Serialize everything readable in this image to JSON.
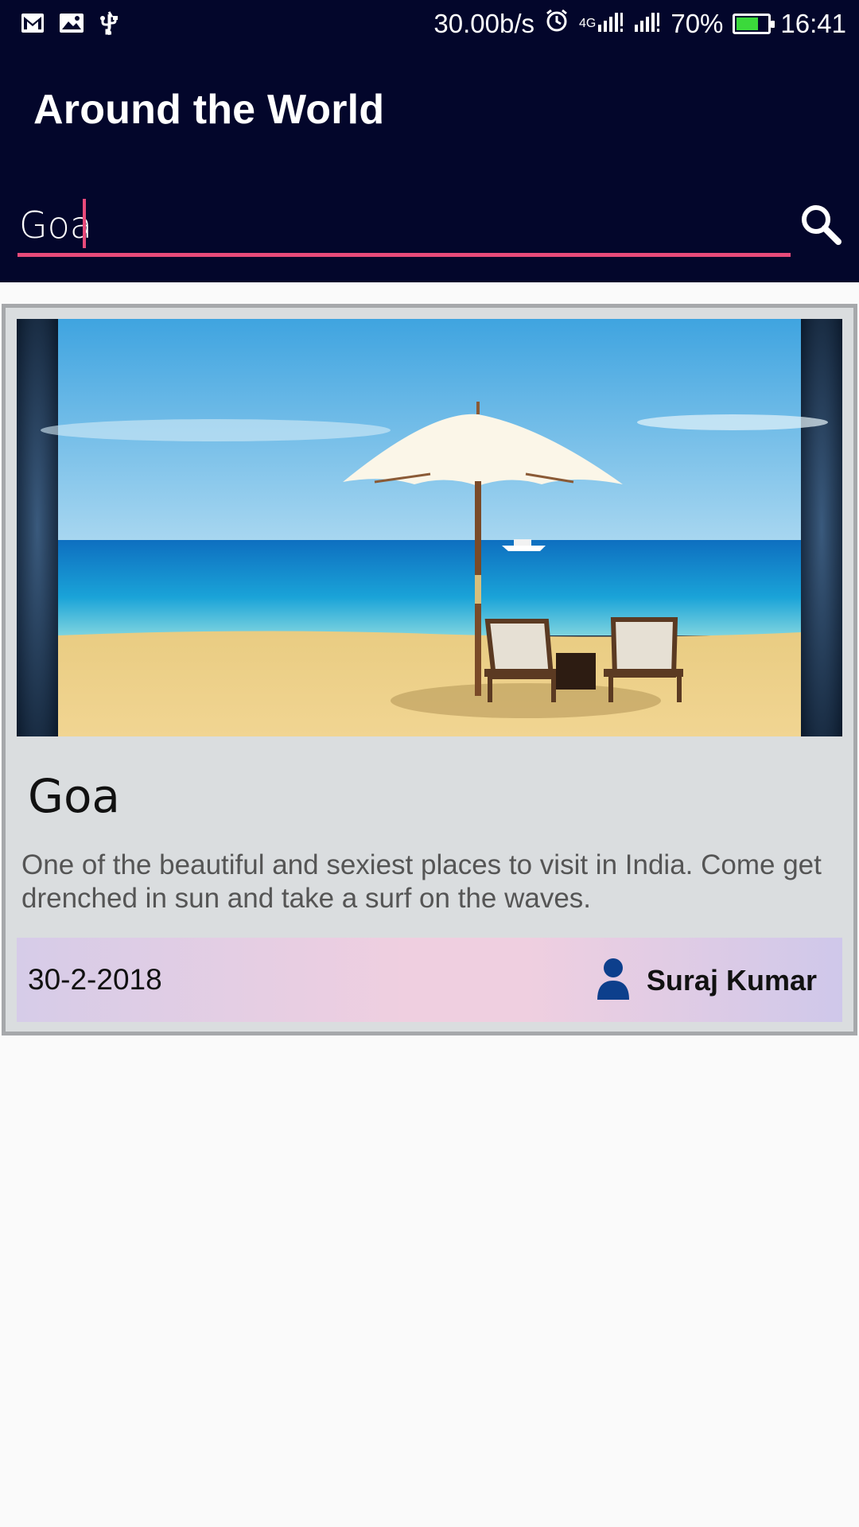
{
  "status_bar": {
    "net_speed": "30.00b/s",
    "network_label": "4G",
    "battery": "70%",
    "battery_level": 0.7,
    "time": "16:41",
    "battery_color": "#3bd93b"
  },
  "app_bar": {
    "title": "Around the World",
    "background": "#03062b"
  },
  "search": {
    "value": "Goa",
    "accent": "#e84a7a",
    "icon": "search-icon"
  },
  "card": {
    "image_icon": "beach-umbrella-image",
    "title": "Goa",
    "description": "One of the beautiful  and sexiest places to visit in India. Come get drenched in sun and take a surf on the waves.",
    "date": "30-2-2018",
    "author_icon": "person-icon",
    "author": "Suraj Kumar"
  }
}
